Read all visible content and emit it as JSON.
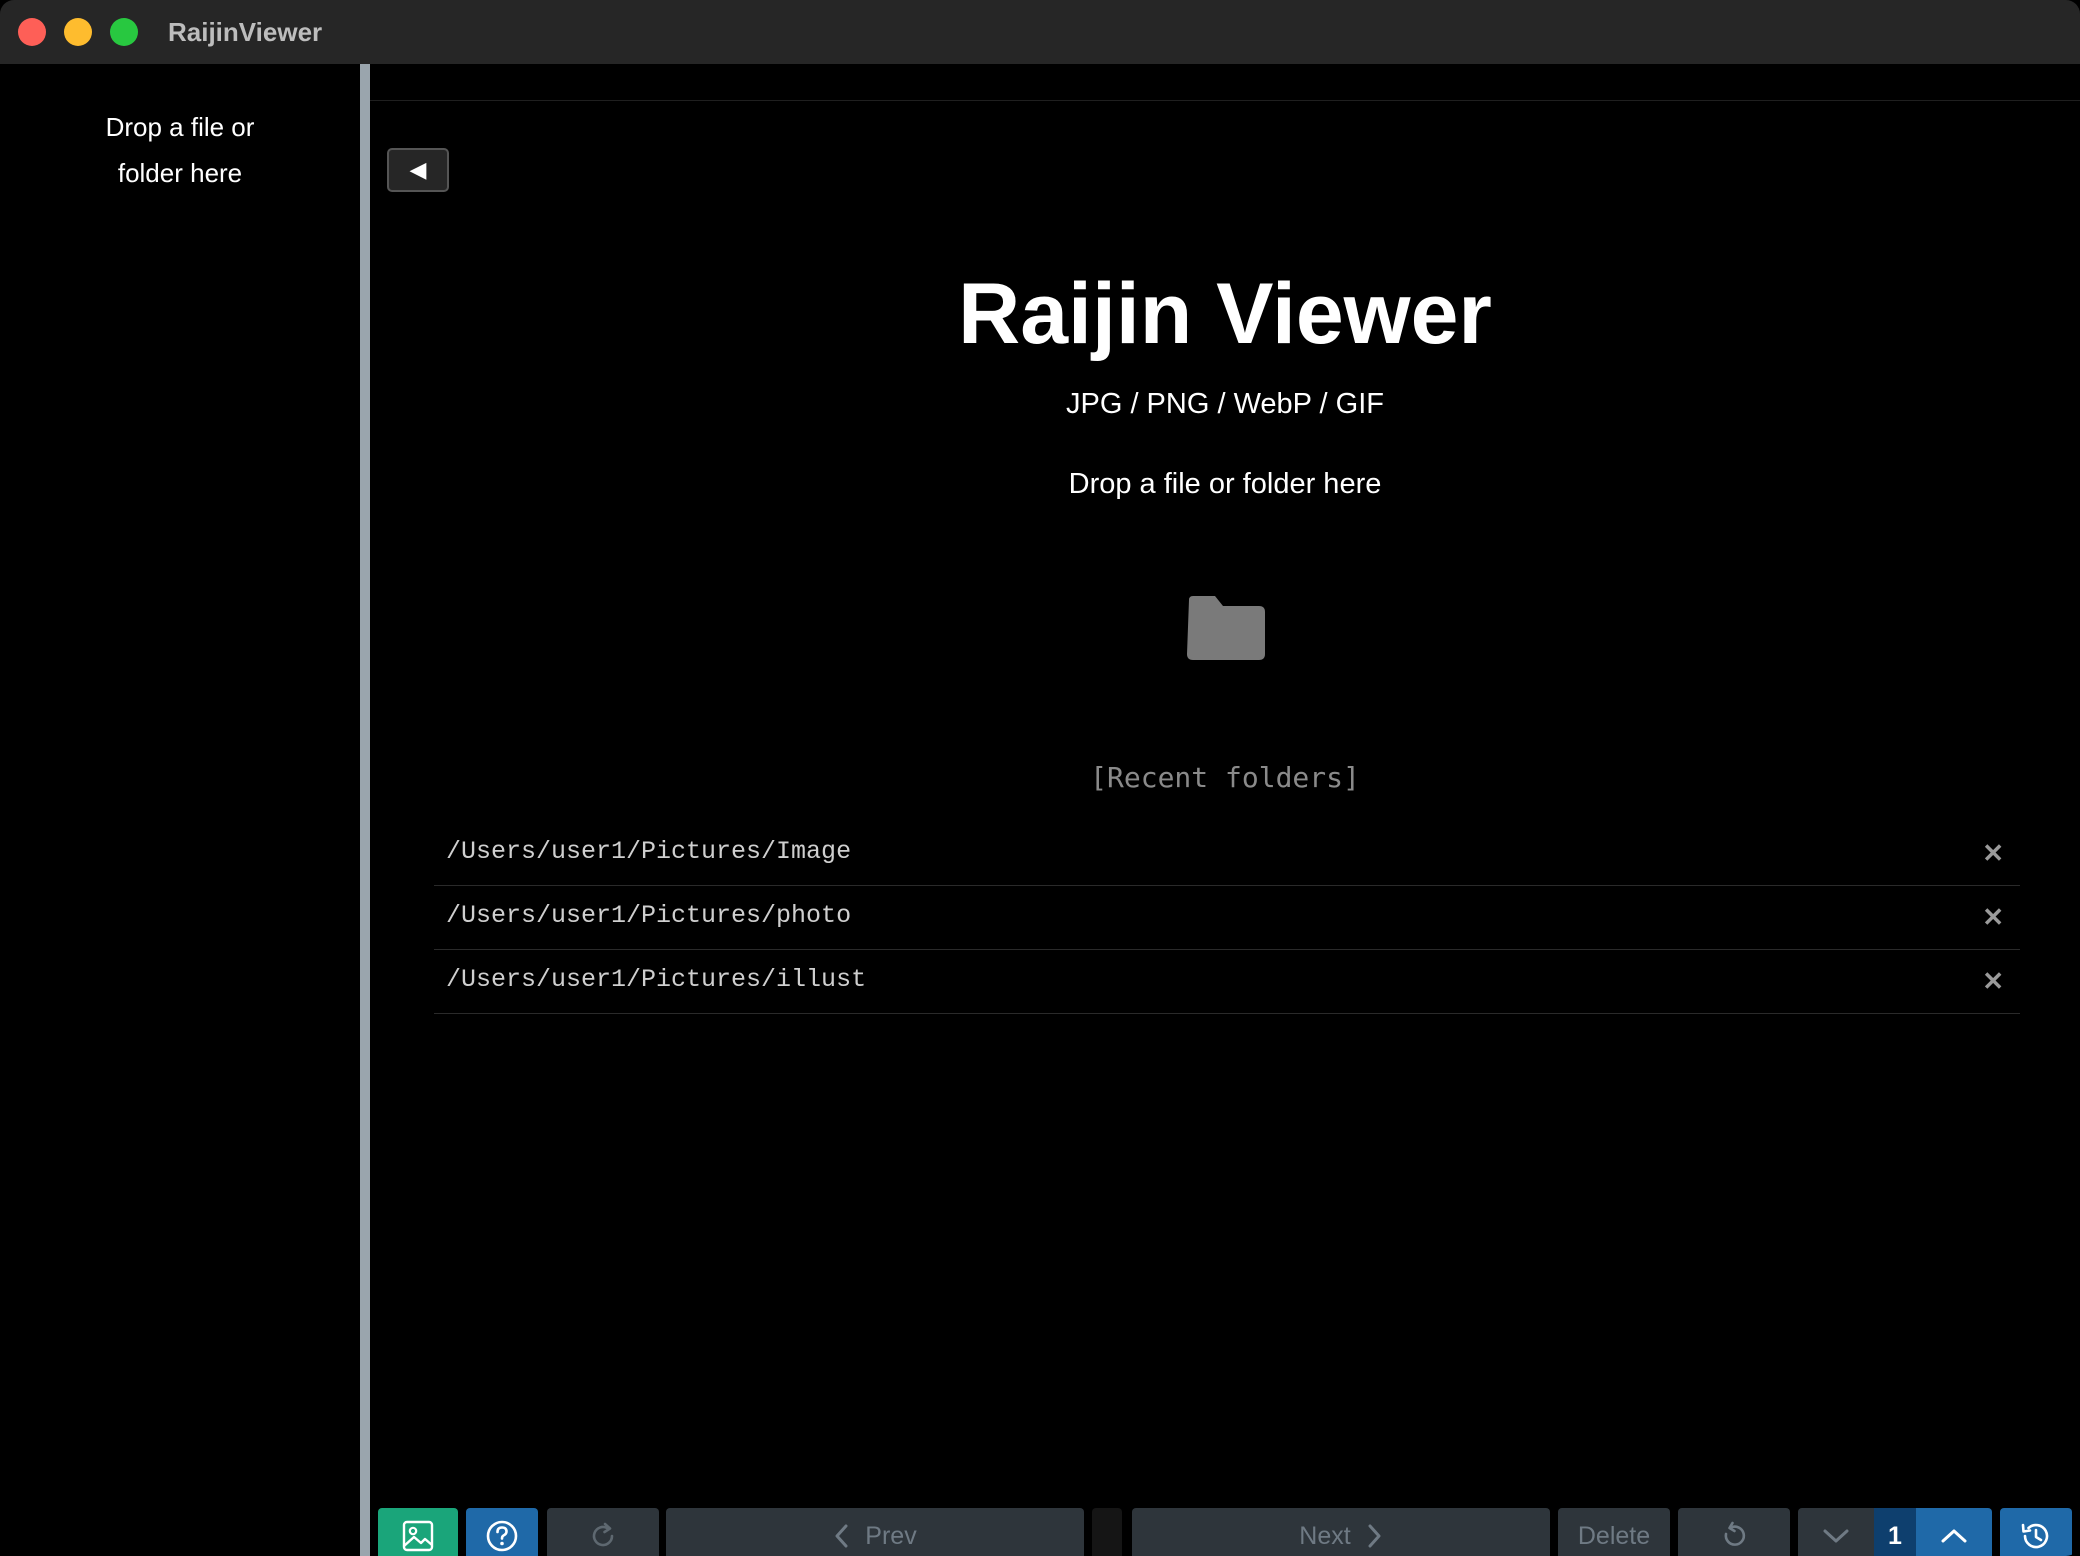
{
  "window": {
    "title": "RaijinViewer"
  },
  "sidebar": {
    "drop_hint": "Drop a file or folder here"
  },
  "main": {
    "collapse_glyph": "◀",
    "title": "Raijin Viewer",
    "formats": "JPG / PNG / WebP / GIF",
    "drop_hint": "Drop a file or folder here",
    "recent_title": "[Recent folders]",
    "recent_folders": [
      "/Users/user1/Pictures/Image",
      "/Users/user1/Pictures/photo",
      "/Users/user1/Pictures/illust"
    ],
    "remove_glyph": "✕"
  },
  "toolbar": {
    "prev_label": "Prev",
    "next_label": "Next",
    "delete_label": "Delete",
    "page_number": "1"
  },
  "icons": {
    "gallery": "image-icon",
    "help": "question-circle-icon",
    "reload": "reload-icon",
    "rotate": "rotate-left-icon",
    "down": "chevron-down-icon",
    "up": "chevron-up-icon",
    "history": "history-icon",
    "folder": "folder-icon"
  },
  "colors": {
    "gallery_button": "#1aa57a",
    "accent_button": "#1f69a8",
    "disabled_button": "#2e353b",
    "page_indicator": "#0e3f6e"
  }
}
